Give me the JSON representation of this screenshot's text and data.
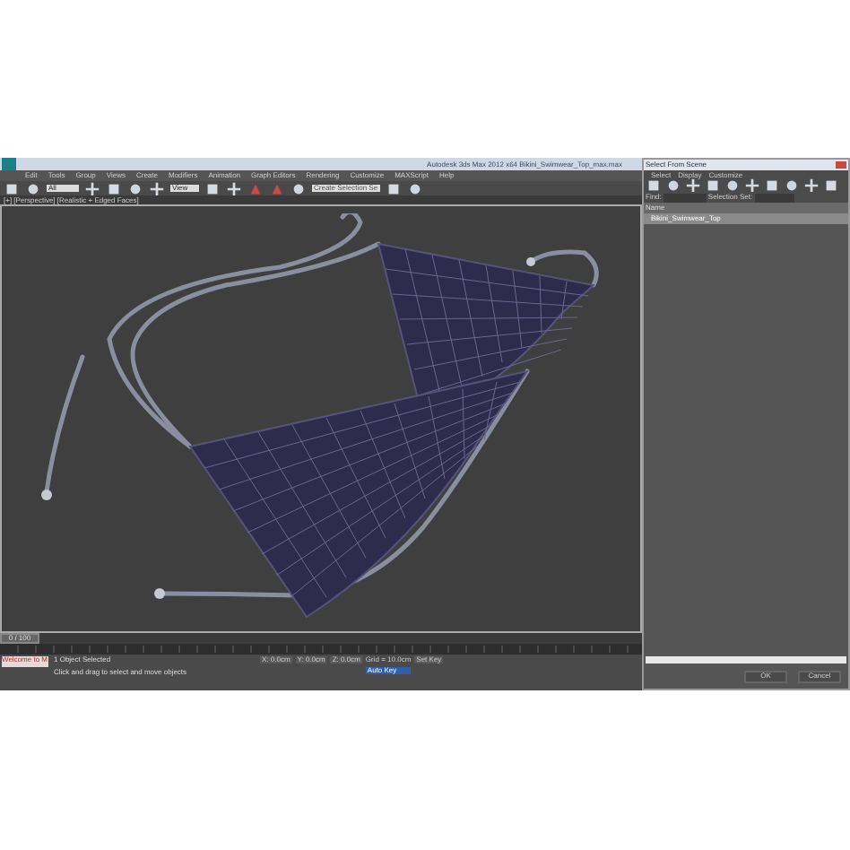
{
  "window": {
    "title": "Autodesk 3ds Max 2012 x64    Bikini_Swimwear_Top_max.max"
  },
  "menu": [
    "Edit",
    "Tools",
    "Group",
    "Views",
    "Create",
    "Modifiers",
    "Animation",
    "Graph Editors",
    "Rendering",
    "Customize",
    "MAXScript",
    "Help"
  ],
  "toolbar": {
    "selection_filter": "All",
    "coordinate_system": "View",
    "named_selection": "Create Selection Se"
  },
  "viewport": {
    "label": "[+] [Perspective] [Realistic + Edged Faces]"
  },
  "dialog": {
    "title": "Select From Scene",
    "menu": [
      "Select",
      "Display",
      "Customize"
    ],
    "find_label": "Find:",
    "selection_set_label": "Selection Set:",
    "column": "Name",
    "items": [
      {
        "name": "Bikini_Swimwear_Top",
        "selected": true
      }
    ],
    "buttons": [
      "OK",
      "Cancel"
    ]
  },
  "timeline": {
    "position": "0 / 100",
    "level": 0
  },
  "status": {
    "script_prompt": "Welcome to M",
    "selection": "1 Object Selected",
    "hint": "Click and drag to select and move objects",
    "x": "X: 0.0cm",
    "y": "Y: 0.0cm",
    "z": "Z: 0.0cm",
    "grid": "Grid = 10.0cm",
    "auto_key": "Auto Key",
    "set_key": "Set Key"
  }
}
